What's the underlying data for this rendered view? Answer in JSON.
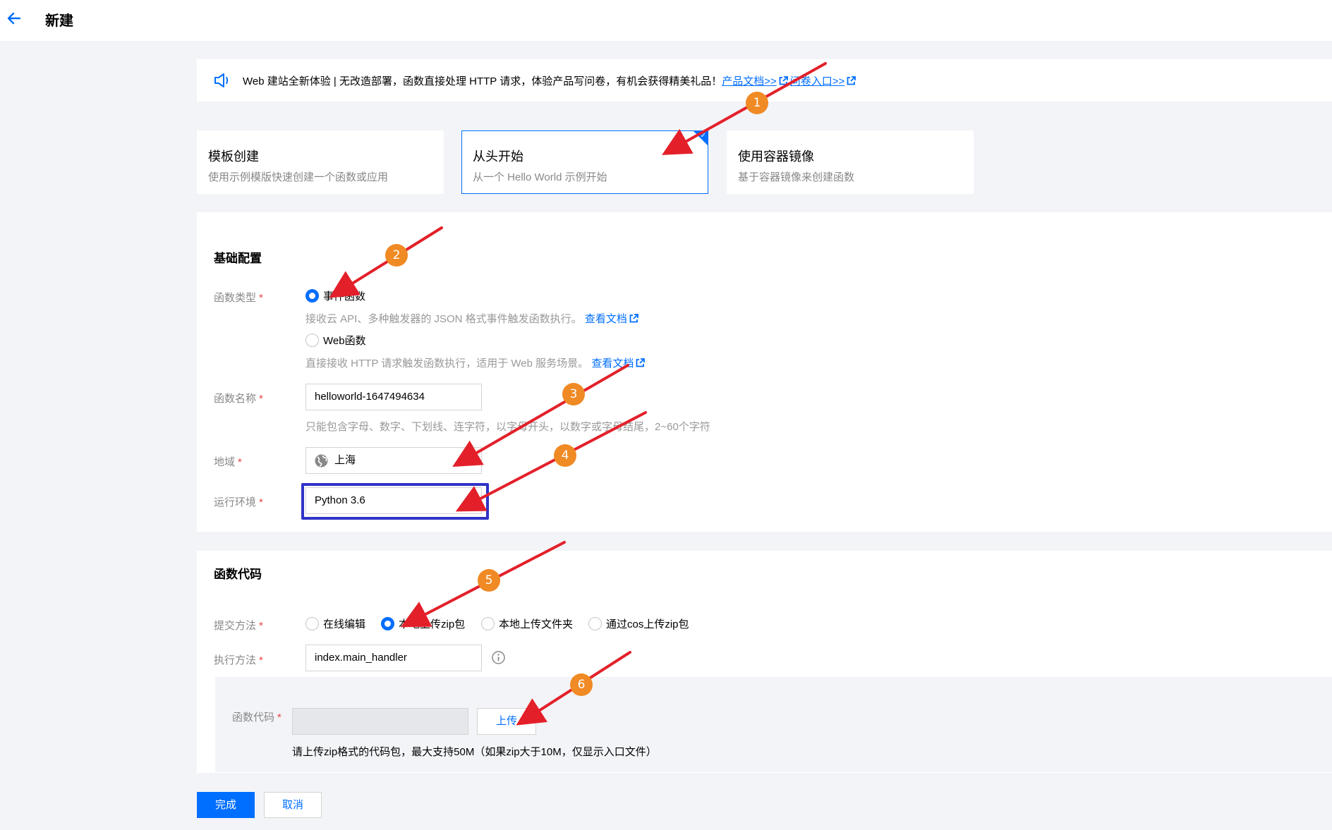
{
  "header": {
    "title": "新建"
  },
  "notice": {
    "text": "Web 建站全新体验 | 无改造部署，函数直接处理 HTTP 请求，体验产品写问卷，有机会获得精美礼品！",
    "link_docs": "产品文档>>",
    "link_survey": "问卷入口>>"
  },
  "modes": [
    {
      "title": "模板创建",
      "desc": "使用示例模版快速创建一个函数或应用",
      "selected": false
    },
    {
      "title": "从头开始",
      "desc": "从一个 Hello World 示例开始",
      "selected": true
    },
    {
      "title": "使用容器镜像",
      "desc": "基于容器镜像来创建函数",
      "selected": false
    }
  ],
  "basic": {
    "section_title": "基础配置",
    "type_label": "函数类型",
    "type_event": "事件函数",
    "type_event_hint": "接收云 API、多种触发器的 JSON 格式事件触发函数执行。",
    "type_web": "Web函数",
    "type_web_hint": "直接接收 HTTP 请求触发函数执行，适用于 Web 服务场景。",
    "doc_link": "查看文档",
    "name_label": "函数名称",
    "name_value": "helloworld-1647494634",
    "name_hint": "只能包含字母、数字、下划线、连字符，以字母开头，以数字或字母结尾，2~60个字符",
    "region_label": "地域",
    "region_value": "上海",
    "runtime_label": "运行环境",
    "runtime_value": "Python 3.6"
  },
  "code": {
    "section_title": "函数代码",
    "submit_label": "提交方法",
    "submit_options": [
      "在线编辑",
      "本地上传zip包",
      "本地上传文件夹",
      "通过cos上传zip包"
    ],
    "submit_selected": 1,
    "handler_label": "执行方法",
    "handler_value": "index.main_handler",
    "code_label": "函数代码",
    "upload_button": "上传",
    "upload_tip": "请上传zip格式的代码包，最大支持50M（如果zip大于10M，仅显示入口文件）"
  },
  "footer": {
    "confirm": "完成",
    "cancel": "取消"
  },
  "annotations": [
    "1",
    "2",
    "3",
    "4",
    "5",
    "6"
  ],
  "colors": {
    "accent": "#006eff",
    "annotation_arrow": "#e3202a",
    "annotation_badge": "#f08a24",
    "highlight_box": "#3033c6",
    "required": "#e54545"
  }
}
